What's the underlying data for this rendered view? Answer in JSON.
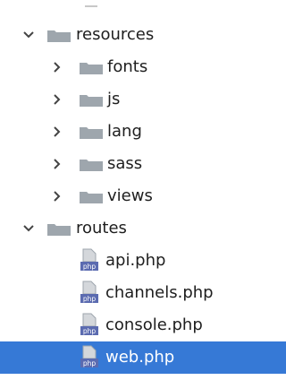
{
  "tree": {
    "items": [
      {
        "label": "resources",
        "type": "folder",
        "expanded": true
      },
      {
        "label": "fonts",
        "type": "folder",
        "expanded": false
      },
      {
        "label": "js",
        "type": "folder",
        "expanded": false
      },
      {
        "label": "lang",
        "type": "folder",
        "expanded": false
      },
      {
        "label": "sass",
        "type": "folder",
        "expanded": false
      },
      {
        "label": "views",
        "type": "folder",
        "expanded": false
      },
      {
        "label": "routes",
        "type": "folder",
        "expanded": true
      },
      {
        "label": "api.php",
        "type": "file",
        "icon_badge": "php"
      },
      {
        "label": "channels.php",
        "type": "file",
        "icon_badge": "php"
      },
      {
        "label": "console.php",
        "type": "file",
        "icon_badge": "php"
      },
      {
        "label": "web.php",
        "type": "file",
        "icon_badge": "php",
        "selected": true
      }
    ]
  },
  "colors": {
    "selection": "#3679d6",
    "folder": "#9ea6ad",
    "chevron": "#444444",
    "php_badge": "#5b6bb0"
  },
  "icons": {
    "expanded": "chevron-down-icon",
    "collapsed": "chevron-right-icon",
    "folder": "folder-icon",
    "file": "php-file-icon"
  }
}
